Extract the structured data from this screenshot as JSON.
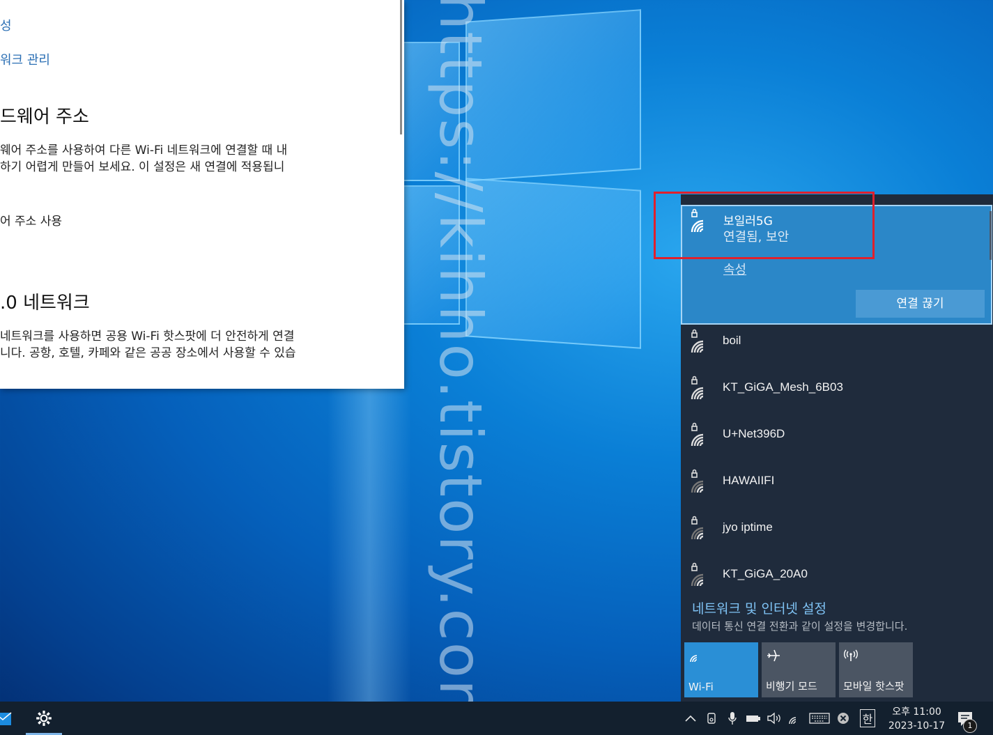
{
  "settings_window": {
    "link_properties": "성",
    "link_manage": "워크 관리",
    "hw_address_heading": "드웨어 주소",
    "hw_address_desc_line1": "웨어 주소를 사용하여 다른 Wi-Fi 네트워크에 연결할 때 내",
    "hw_address_desc_line2": "하기 어렵게 만들어 보세요. 이 설정은 새 연결에 적용됩니",
    "hw_address_toggle_label": "어 주소 사용",
    "hotspot_heading": ".0 네트워크",
    "hotspot_desc_line1": "네트워크를 사용하면 공용 Wi-Fi 핫스팟에 더 안전하게 연결",
    "hotspot_desc_line2": "니다. 공항, 호텔, 카페와 같은 공공 장소에서 사용할 수 있습"
  },
  "watermark": "https://kihho.tistory.com",
  "network_flyout": {
    "connected": {
      "name": "보일러5G",
      "status": "연결됨, 보안",
      "properties_link": "속성",
      "disconnect_label": "연결 끊기"
    },
    "networks": [
      {
        "name": "boil"
      },
      {
        "name": "KT_GiGA_Mesh_6B03"
      },
      {
        "name": "U+Net396D"
      },
      {
        "name": "HAWAIIFI"
      },
      {
        "name": "jyo iptime"
      },
      {
        "name": "KT_GiGA_20A0"
      }
    ],
    "settings_link": "네트워크 및 인터넷 설정",
    "settings_desc": "데이터 통신 연결 전환과 같이 설정을 변경합니다.",
    "quick_actions": [
      {
        "label": "Wi-Fi",
        "icon": "wifi-icon",
        "active": true
      },
      {
        "label": "비행기 모드",
        "icon": "airplane-icon",
        "active": false
      },
      {
        "label": "모바일 핫스팟",
        "icon": "hotspot-icon",
        "active": false
      }
    ]
  },
  "taskbar": {
    "ime_label": "한",
    "clock_time": "오후 11:00",
    "clock_date": "2023-10-17",
    "notification_count": "1"
  },
  "colors": {
    "highlight_box": "#e0202c",
    "connected_bg": "#2b87c8",
    "flyout_bg": "#1f2b3c"
  }
}
